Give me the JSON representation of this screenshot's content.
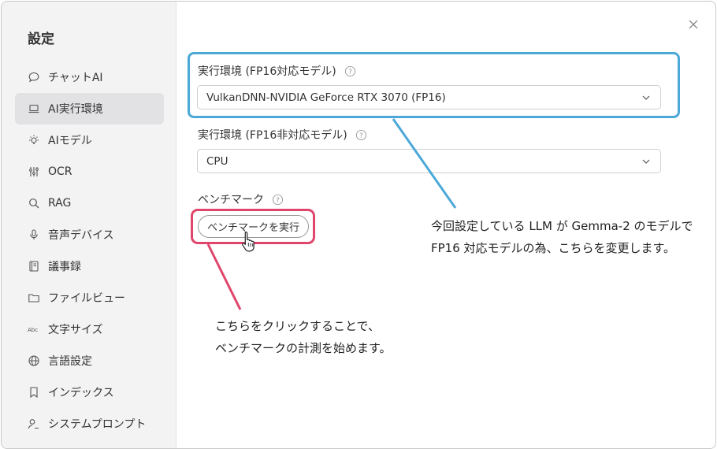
{
  "sidebar": {
    "title": "設定",
    "items": [
      {
        "label": "チャットAI",
        "icon": "chat-bubble-icon",
        "active": false
      },
      {
        "label": "AI実行環境",
        "icon": "laptop-icon",
        "active": true
      },
      {
        "label": "AIモデル",
        "icon": "lightbulb-icon",
        "active": false
      },
      {
        "label": "OCR",
        "icon": "sliders-icon",
        "active": false
      },
      {
        "label": "RAG",
        "icon": "search-icon",
        "active": false
      },
      {
        "label": "音声デバイス",
        "icon": "microphone-icon",
        "active": false
      },
      {
        "label": "議事録",
        "icon": "notebook-icon",
        "active": false
      },
      {
        "label": "ファイルビュー",
        "icon": "folder-icon",
        "active": false
      },
      {
        "label": "文字サイズ",
        "icon": "text-size-icon",
        "active": false
      },
      {
        "label": "言語設定",
        "icon": "globe-icon",
        "active": false
      },
      {
        "label": "インデックス",
        "icon": "bookmark-icon",
        "active": false
      },
      {
        "label": "システムプロンプト",
        "icon": "user-prompt-icon",
        "active": false
      }
    ]
  },
  "main": {
    "fp16_label": "実行環境 (FP16対応モデル)",
    "fp16_value": "VulkanDNN-NVIDIA GeForce RTX 3070 (FP16)",
    "nonfp16_label": "実行環境 (FP16非対応モデル)",
    "nonfp16_value": "CPU",
    "benchmark_label": "ベンチマーク",
    "benchmark_button": "ベンチマークを実行"
  },
  "annotations": {
    "blue_note_line1": "今回設定している LLM が Gemma-2 のモデルで",
    "blue_note_line2": "FP16 対応モデルの為、こちらを変更します。",
    "pink_note_line1": "こちらをクリックすることで、",
    "pink_note_line2": "ベンチマークの計測を始めます。",
    "blue_color": "#4ba8d8",
    "pink_color": "#e0466c"
  },
  "help_icon_glyph": "?"
}
